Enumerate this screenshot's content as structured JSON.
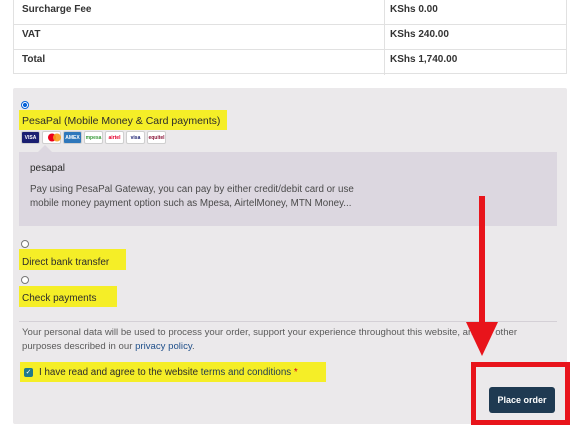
{
  "totals": [
    {
      "label": "Surcharge Fee",
      "value": "KShs 0.00"
    },
    {
      "label": "VAT",
      "value": "KShs 240.00"
    },
    {
      "label": "Total",
      "value": "KShs 1,740.00"
    }
  ],
  "payment_methods": {
    "pesapal": {
      "label": "PesaPal (Mobile Money & Card payments)",
      "selected": true,
      "card_logos": [
        "VISA",
        "mastercard",
        "AMEX",
        "mpesa",
        "airtel",
        "visa",
        "equitel"
      ],
      "description_title": "pesapal",
      "description": "Pay using PesaPal Gateway, you can pay by either credit/debit card or use mobile money payment option such as Mpesa, AirtelMoney, MTN Money..."
    },
    "bank_transfer": {
      "label": "Direct bank transfer",
      "selected": false
    },
    "check": {
      "label": "Check payments",
      "selected": false
    }
  },
  "privacy": {
    "text": "Your personal data will be used to process your order, support your experience throughout this website, and for other purposes described in our",
    "link": "privacy policy",
    "end": "."
  },
  "terms": {
    "text": "I have read and agree to the website",
    "link": "terms and conditions",
    "required": "*",
    "checked": true
  },
  "place_order_label": "Place order",
  "colors": {
    "highlight": "#f5ee27",
    "annotation_red": "#e8141b",
    "button": "#1f3a52",
    "panel": "#ebe9eb"
  }
}
